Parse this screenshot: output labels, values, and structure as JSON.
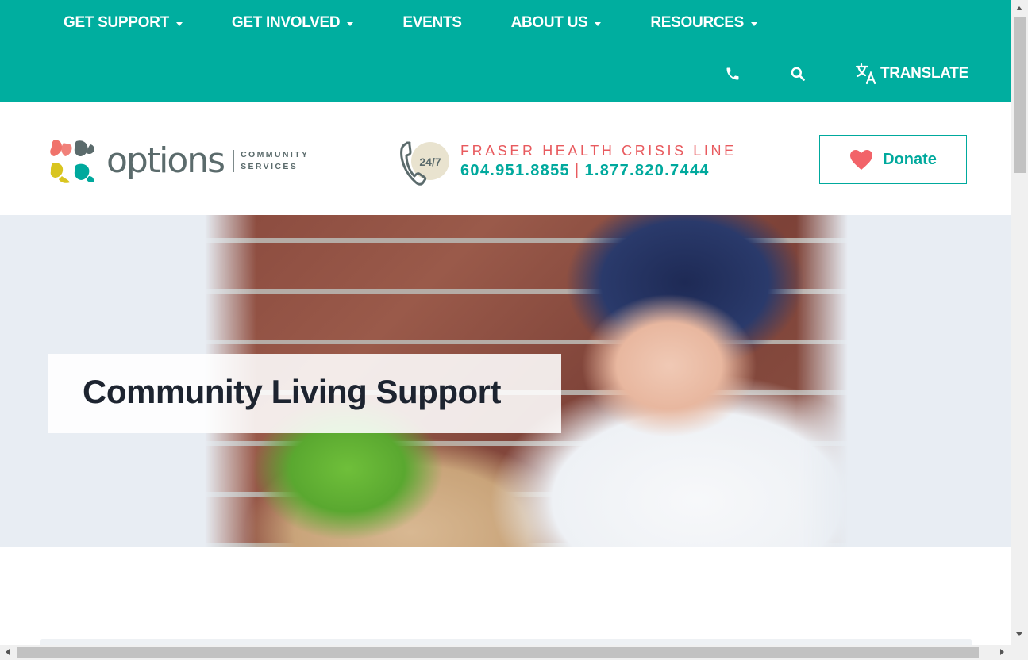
{
  "nav": {
    "items": [
      {
        "label": "GET SUPPORT",
        "dropdown": true
      },
      {
        "label": "GET INVOLVED",
        "dropdown": true
      },
      {
        "label": "EVENTS",
        "dropdown": false
      },
      {
        "label": "ABOUT US",
        "dropdown": true
      },
      {
        "label": "RESOURCES",
        "dropdown": true
      }
    ],
    "phone_icon": "phone-icon",
    "search_icon": "search-icon",
    "translate_icon": "translate-icon",
    "translate_label": "TRANSLATE"
  },
  "header": {
    "logo": {
      "word": "options",
      "sub_line1": "COMMUNITY",
      "sub_line2": "SERVICES"
    },
    "crisis": {
      "badge": "24/7",
      "title": "FRASER HEALTH CRISIS LINE",
      "phone1": "604.951.8855",
      "separator": "|",
      "phone2": "1.877.820.7444"
    },
    "donate_label": "Donate"
  },
  "hero": {
    "title": "Community Living Support"
  },
  "colors": {
    "brand_teal": "#00ae9f",
    "accent_red": "#e85a5e",
    "heading_dark": "#1d2430"
  }
}
